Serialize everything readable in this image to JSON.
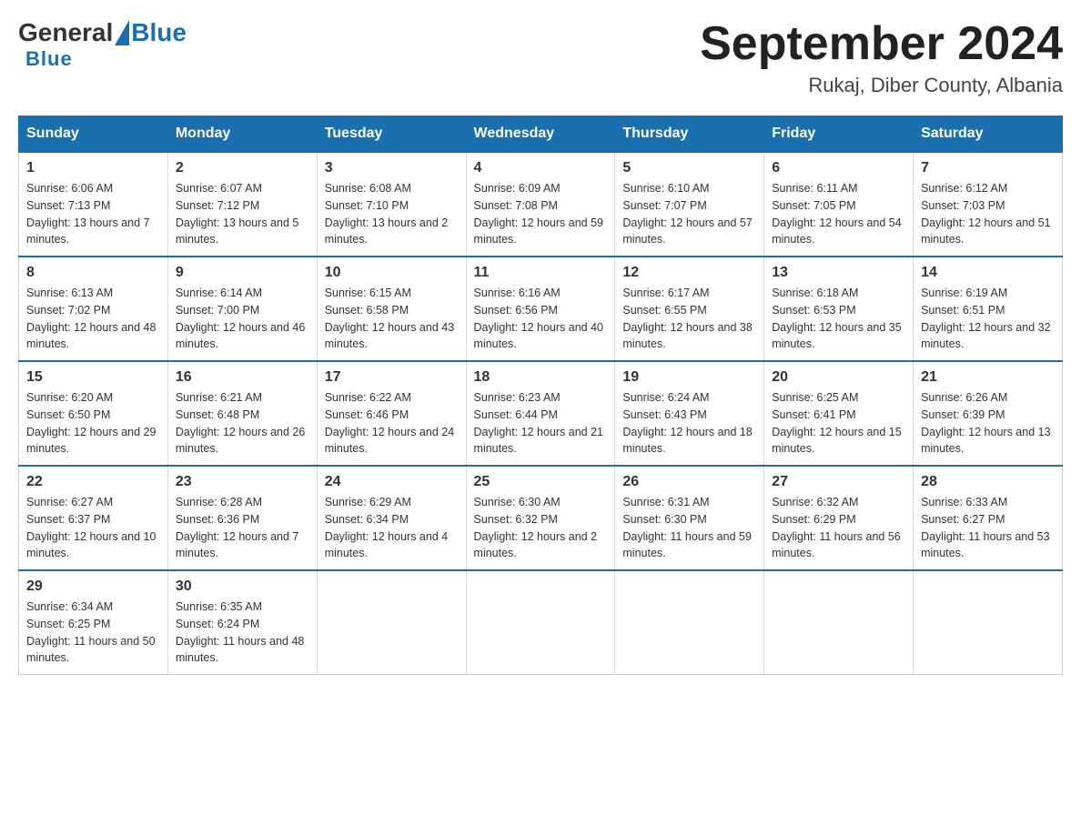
{
  "header": {
    "logo_general": "General",
    "logo_blue": "Blue",
    "calendar_title": "September 2024",
    "calendar_subtitle": "Rukaj, Diber County, Albania"
  },
  "days_of_week": [
    "Sunday",
    "Monday",
    "Tuesday",
    "Wednesday",
    "Thursday",
    "Friday",
    "Saturday"
  ],
  "weeks": [
    [
      {
        "day": "1",
        "sunrise": "6:06 AM",
        "sunset": "7:13 PM",
        "daylight": "13 hours and 7 minutes."
      },
      {
        "day": "2",
        "sunrise": "6:07 AM",
        "sunset": "7:12 PM",
        "daylight": "13 hours and 5 minutes."
      },
      {
        "day": "3",
        "sunrise": "6:08 AM",
        "sunset": "7:10 PM",
        "daylight": "13 hours and 2 minutes."
      },
      {
        "day": "4",
        "sunrise": "6:09 AM",
        "sunset": "7:08 PM",
        "daylight": "12 hours and 59 minutes."
      },
      {
        "day": "5",
        "sunrise": "6:10 AM",
        "sunset": "7:07 PM",
        "daylight": "12 hours and 57 minutes."
      },
      {
        "day": "6",
        "sunrise": "6:11 AM",
        "sunset": "7:05 PM",
        "daylight": "12 hours and 54 minutes."
      },
      {
        "day": "7",
        "sunrise": "6:12 AM",
        "sunset": "7:03 PM",
        "daylight": "12 hours and 51 minutes."
      }
    ],
    [
      {
        "day": "8",
        "sunrise": "6:13 AM",
        "sunset": "7:02 PM",
        "daylight": "12 hours and 48 minutes."
      },
      {
        "day": "9",
        "sunrise": "6:14 AM",
        "sunset": "7:00 PM",
        "daylight": "12 hours and 46 minutes."
      },
      {
        "day": "10",
        "sunrise": "6:15 AM",
        "sunset": "6:58 PM",
        "daylight": "12 hours and 43 minutes."
      },
      {
        "day": "11",
        "sunrise": "6:16 AM",
        "sunset": "6:56 PM",
        "daylight": "12 hours and 40 minutes."
      },
      {
        "day": "12",
        "sunrise": "6:17 AM",
        "sunset": "6:55 PM",
        "daylight": "12 hours and 38 minutes."
      },
      {
        "day": "13",
        "sunrise": "6:18 AM",
        "sunset": "6:53 PM",
        "daylight": "12 hours and 35 minutes."
      },
      {
        "day": "14",
        "sunrise": "6:19 AM",
        "sunset": "6:51 PM",
        "daylight": "12 hours and 32 minutes."
      }
    ],
    [
      {
        "day": "15",
        "sunrise": "6:20 AM",
        "sunset": "6:50 PM",
        "daylight": "12 hours and 29 minutes."
      },
      {
        "day": "16",
        "sunrise": "6:21 AM",
        "sunset": "6:48 PM",
        "daylight": "12 hours and 26 minutes."
      },
      {
        "day": "17",
        "sunrise": "6:22 AM",
        "sunset": "6:46 PM",
        "daylight": "12 hours and 24 minutes."
      },
      {
        "day": "18",
        "sunrise": "6:23 AM",
        "sunset": "6:44 PM",
        "daylight": "12 hours and 21 minutes."
      },
      {
        "day": "19",
        "sunrise": "6:24 AM",
        "sunset": "6:43 PM",
        "daylight": "12 hours and 18 minutes."
      },
      {
        "day": "20",
        "sunrise": "6:25 AM",
        "sunset": "6:41 PM",
        "daylight": "12 hours and 15 minutes."
      },
      {
        "day": "21",
        "sunrise": "6:26 AM",
        "sunset": "6:39 PM",
        "daylight": "12 hours and 13 minutes."
      }
    ],
    [
      {
        "day": "22",
        "sunrise": "6:27 AM",
        "sunset": "6:37 PM",
        "daylight": "12 hours and 10 minutes."
      },
      {
        "day": "23",
        "sunrise": "6:28 AM",
        "sunset": "6:36 PM",
        "daylight": "12 hours and 7 minutes."
      },
      {
        "day": "24",
        "sunrise": "6:29 AM",
        "sunset": "6:34 PM",
        "daylight": "12 hours and 4 minutes."
      },
      {
        "day": "25",
        "sunrise": "6:30 AM",
        "sunset": "6:32 PM",
        "daylight": "12 hours and 2 minutes."
      },
      {
        "day": "26",
        "sunrise": "6:31 AM",
        "sunset": "6:30 PM",
        "daylight": "11 hours and 59 minutes."
      },
      {
        "day": "27",
        "sunrise": "6:32 AM",
        "sunset": "6:29 PM",
        "daylight": "11 hours and 56 minutes."
      },
      {
        "day": "28",
        "sunrise": "6:33 AM",
        "sunset": "6:27 PM",
        "daylight": "11 hours and 53 minutes."
      }
    ],
    [
      {
        "day": "29",
        "sunrise": "6:34 AM",
        "sunset": "6:25 PM",
        "daylight": "11 hours and 50 minutes."
      },
      {
        "day": "30",
        "sunrise": "6:35 AM",
        "sunset": "6:24 PM",
        "daylight": "11 hours and 48 minutes."
      },
      null,
      null,
      null,
      null,
      null
    ]
  ]
}
